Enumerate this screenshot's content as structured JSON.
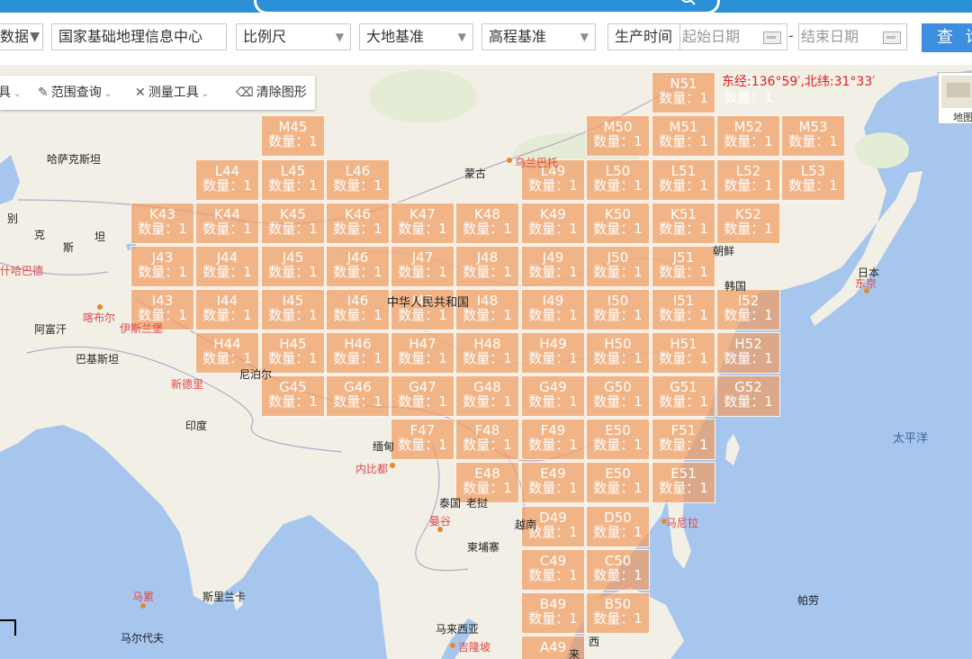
{
  "filters": {
    "data_type": "数据",
    "agency": "国家基础地理信息中心",
    "scale": "比例尺",
    "geodetic_datum": "大地基准",
    "height_datum": "高程基准",
    "production_time_label": "生产时间",
    "start_date_placeholder": "起始日期",
    "separator": "-",
    "end_date_placeholder": "结束日期",
    "query_button": "查 询"
  },
  "toolbar": {
    "range_query": "范围查询",
    "measure_tools": "测量工具",
    "clear_shapes": "清除图形"
  },
  "coordinate_readout": "东经:136°59′,北纬:31°33′",
  "layer_switch_label": "地图",
  "count_label": "数量：",
  "tiles": [
    {
      "code": "N51",
      "count": "1"
    },
    {
      "code": "N52",
      "count": "1"
    },
    {
      "code": "M45",
      "count": "1"
    },
    {
      "code": "M50",
      "count": "1"
    },
    {
      "code": "M51",
      "count": "1"
    },
    {
      "code": "M52",
      "count": "1"
    },
    {
      "code": "M53",
      "count": "1"
    },
    {
      "code": "L44",
      "count": "1"
    },
    {
      "code": "L45",
      "count": "1"
    },
    {
      "code": "L46",
      "count": "1"
    },
    {
      "code": "L49",
      "count": "1"
    },
    {
      "code": "L50",
      "count": "1"
    },
    {
      "code": "L51",
      "count": "1"
    },
    {
      "code": "L52",
      "count": "1"
    },
    {
      "code": "L53",
      "count": "1"
    },
    {
      "code": "K43",
      "count": "1"
    },
    {
      "code": "K44",
      "count": "1"
    },
    {
      "code": "K45",
      "count": "1"
    },
    {
      "code": "K46",
      "count": "1"
    },
    {
      "code": "K47",
      "count": "1"
    },
    {
      "code": "K48",
      "count": "1"
    },
    {
      "code": "K49",
      "count": "1"
    },
    {
      "code": "K50",
      "count": "1"
    },
    {
      "code": "K51",
      "count": "1"
    },
    {
      "code": "K52",
      "count": "1"
    },
    {
      "code": "J43",
      "count": "1"
    },
    {
      "code": "J44",
      "count": "1"
    },
    {
      "code": "J45",
      "count": "1"
    },
    {
      "code": "J46",
      "count": "1"
    },
    {
      "code": "J47",
      "count": "1"
    },
    {
      "code": "J48",
      "count": "1"
    },
    {
      "code": "J49",
      "count": "1"
    },
    {
      "code": "J50",
      "count": "1"
    },
    {
      "code": "J51",
      "count": "1"
    },
    {
      "code": "I43",
      "count": "1"
    },
    {
      "code": "I44",
      "count": "1"
    },
    {
      "code": "I45",
      "count": "1"
    },
    {
      "code": "I46",
      "count": "1"
    },
    {
      "code": "I47",
      "count": "1"
    },
    {
      "code": "I48",
      "count": "1"
    },
    {
      "code": "I49",
      "count": "1"
    },
    {
      "code": "I50",
      "count": "1"
    },
    {
      "code": "I51",
      "count": "1"
    },
    {
      "code": "I52",
      "count": "1"
    },
    {
      "code": "H44",
      "count": "1"
    },
    {
      "code": "H45",
      "count": "1"
    },
    {
      "code": "H46",
      "count": "1"
    },
    {
      "code": "H47",
      "count": "1"
    },
    {
      "code": "H48",
      "count": "1"
    },
    {
      "code": "H49",
      "count": "1"
    },
    {
      "code": "H50",
      "count": "1"
    },
    {
      "code": "H51",
      "count": "1"
    },
    {
      "code": "H52",
      "count": "1"
    },
    {
      "code": "G45",
      "count": "1"
    },
    {
      "code": "G46",
      "count": "1"
    },
    {
      "code": "G47",
      "count": "1"
    },
    {
      "code": "G48",
      "count": "1"
    },
    {
      "code": "G49",
      "count": "1"
    },
    {
      "code": "G50",
      "count": "1"
    },
    {
      "code": "G51",
      "count": "1"
    },
    {
      "code": "G52",
      "count": "1"
    },
    {
      "code": "F47",
      "count": "1"
    },
    {
      "code": "F48",
      "count": "1"
    },
    {
      "code": "F49",
      "count": "1"
    },
    {
      "code": "E50",
      "count": "1"
    },
    {
      "code": "F51",
      "count": "1"
    },
    {
      "code": "E48",
      "count": "1"
    },
    {
      "code": "E49",
      "count": "1"
    },
    {
      "code": "E50",
      "count": "1"
    },
    {
      "code": "E51",
      "count": "1"
    },
    {
      "code": "D49",
      "count": "1"
    },
    {
      "code": "D50",
      "count": "1"
    },
    {
      "code": "C49",
      "count": "1"
    },
    {
      "code": "C50",
      "count": "1"
    },
    {
      "code": "B49",
      "count": "1"
    },
    {
      "code": "B50",
      "count": "1"
    },
    {
      "code": "A49",
      "count": ""
    }
  ],
  "place_labels": [
    "哈萨克斯坦",
    "蒙古",
    "中华人民共和国",
    "朝鲜",
    "韩国",
    "日本",
    "东京",
    "阿富汗",
    "巴基斯坦",
    "喀布尔",
    "伊斯兰堡",
    "新德里",
    "尼泊尔",
    "印度",
    "缅甸",
    "内比都",
    "泰国",
    "曼谷",
    "柬埔寨",
    "老挝",
    "越南",
    "马尼拉",
    "太平洋",
    "斯里兰卡",
    "马累",
    "马尔代夫",
    "马来西亚",
    "吉隆坡",
    "帕劳",
    "别",
    "克",
    "斯",
    "坦",
    "什哈巴德",
    "乌兰巴托",
    "西",
    "来"
  ]
}
